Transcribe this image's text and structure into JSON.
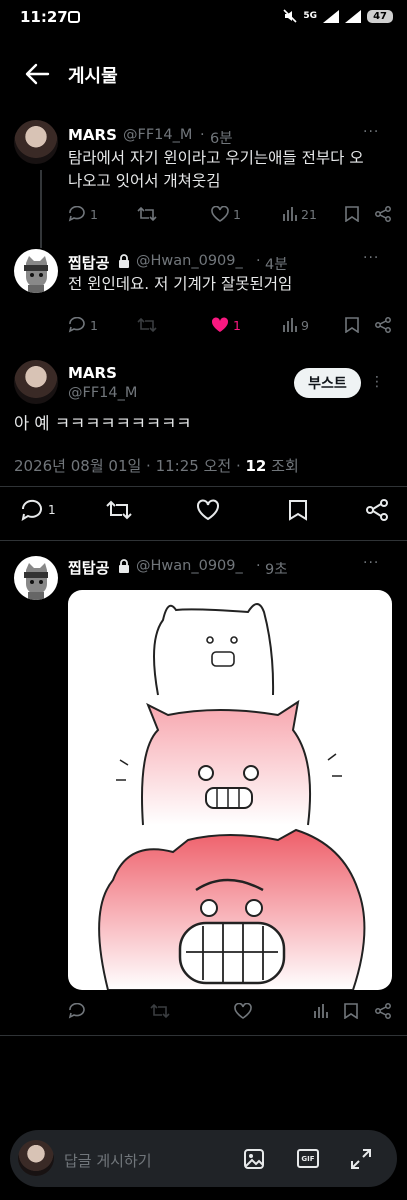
{
  "status_bar": {
    "time": "11:27",
    "network": "5G",
    "battery": "47"
  },
  "header": {
    "title": "게시물"
  },
  "replies": [
    {
      "name": "MARS",
      "handle": "@FF14_M",
      "age": "6분",
      "text_line1": "탐라에서 자기 윈이라고 우기는애들 전부다 오",
      "text_line2": "나오고 잇어서 개쳐웃김",
      "reply_count": "1",
      "retweet_count": "",
      "like_count": "1",
      "view_count": "21",
      "liked": false
    },
    {
      "name": "찝탑공",
      "handle": "@Hwan_0909_",
      "age": "4분",
      "text_line1": "전 윈인데요. 저 기계가 잘못된거임",
      "reply_count": "1",
      "retweet_count": "",
      "like_count": "1",
      "view_count": "9",
      "liked": true
    }
  ],
  "main_post": {
    "name": "MARS",
    "handle": "@FF14_M",
    "boost_label": "부스트",
    "text": "아 예 ㅋㅋㅋㅋㅋㅋㅋㅋㅋ",
    "timestamp": "2026년 08월 01일 · 11:25 오전 · ",
    "view_count": "12",
    "view_label": " 조회",
    "reply_count": "1"
  },
  "last_reply": {
    "name": "찝탑공",
    "handle": "@Hwan_0909_",
    "age": "9초"
  },
  "composer": {
    "placeholder": "답글 게시하기",
    "gif_label": "GIF"
  },
  "colors": {
    "like_active": "#f91880",
    "muted": "#71767b",
    "background": "#000000"
  }
}
